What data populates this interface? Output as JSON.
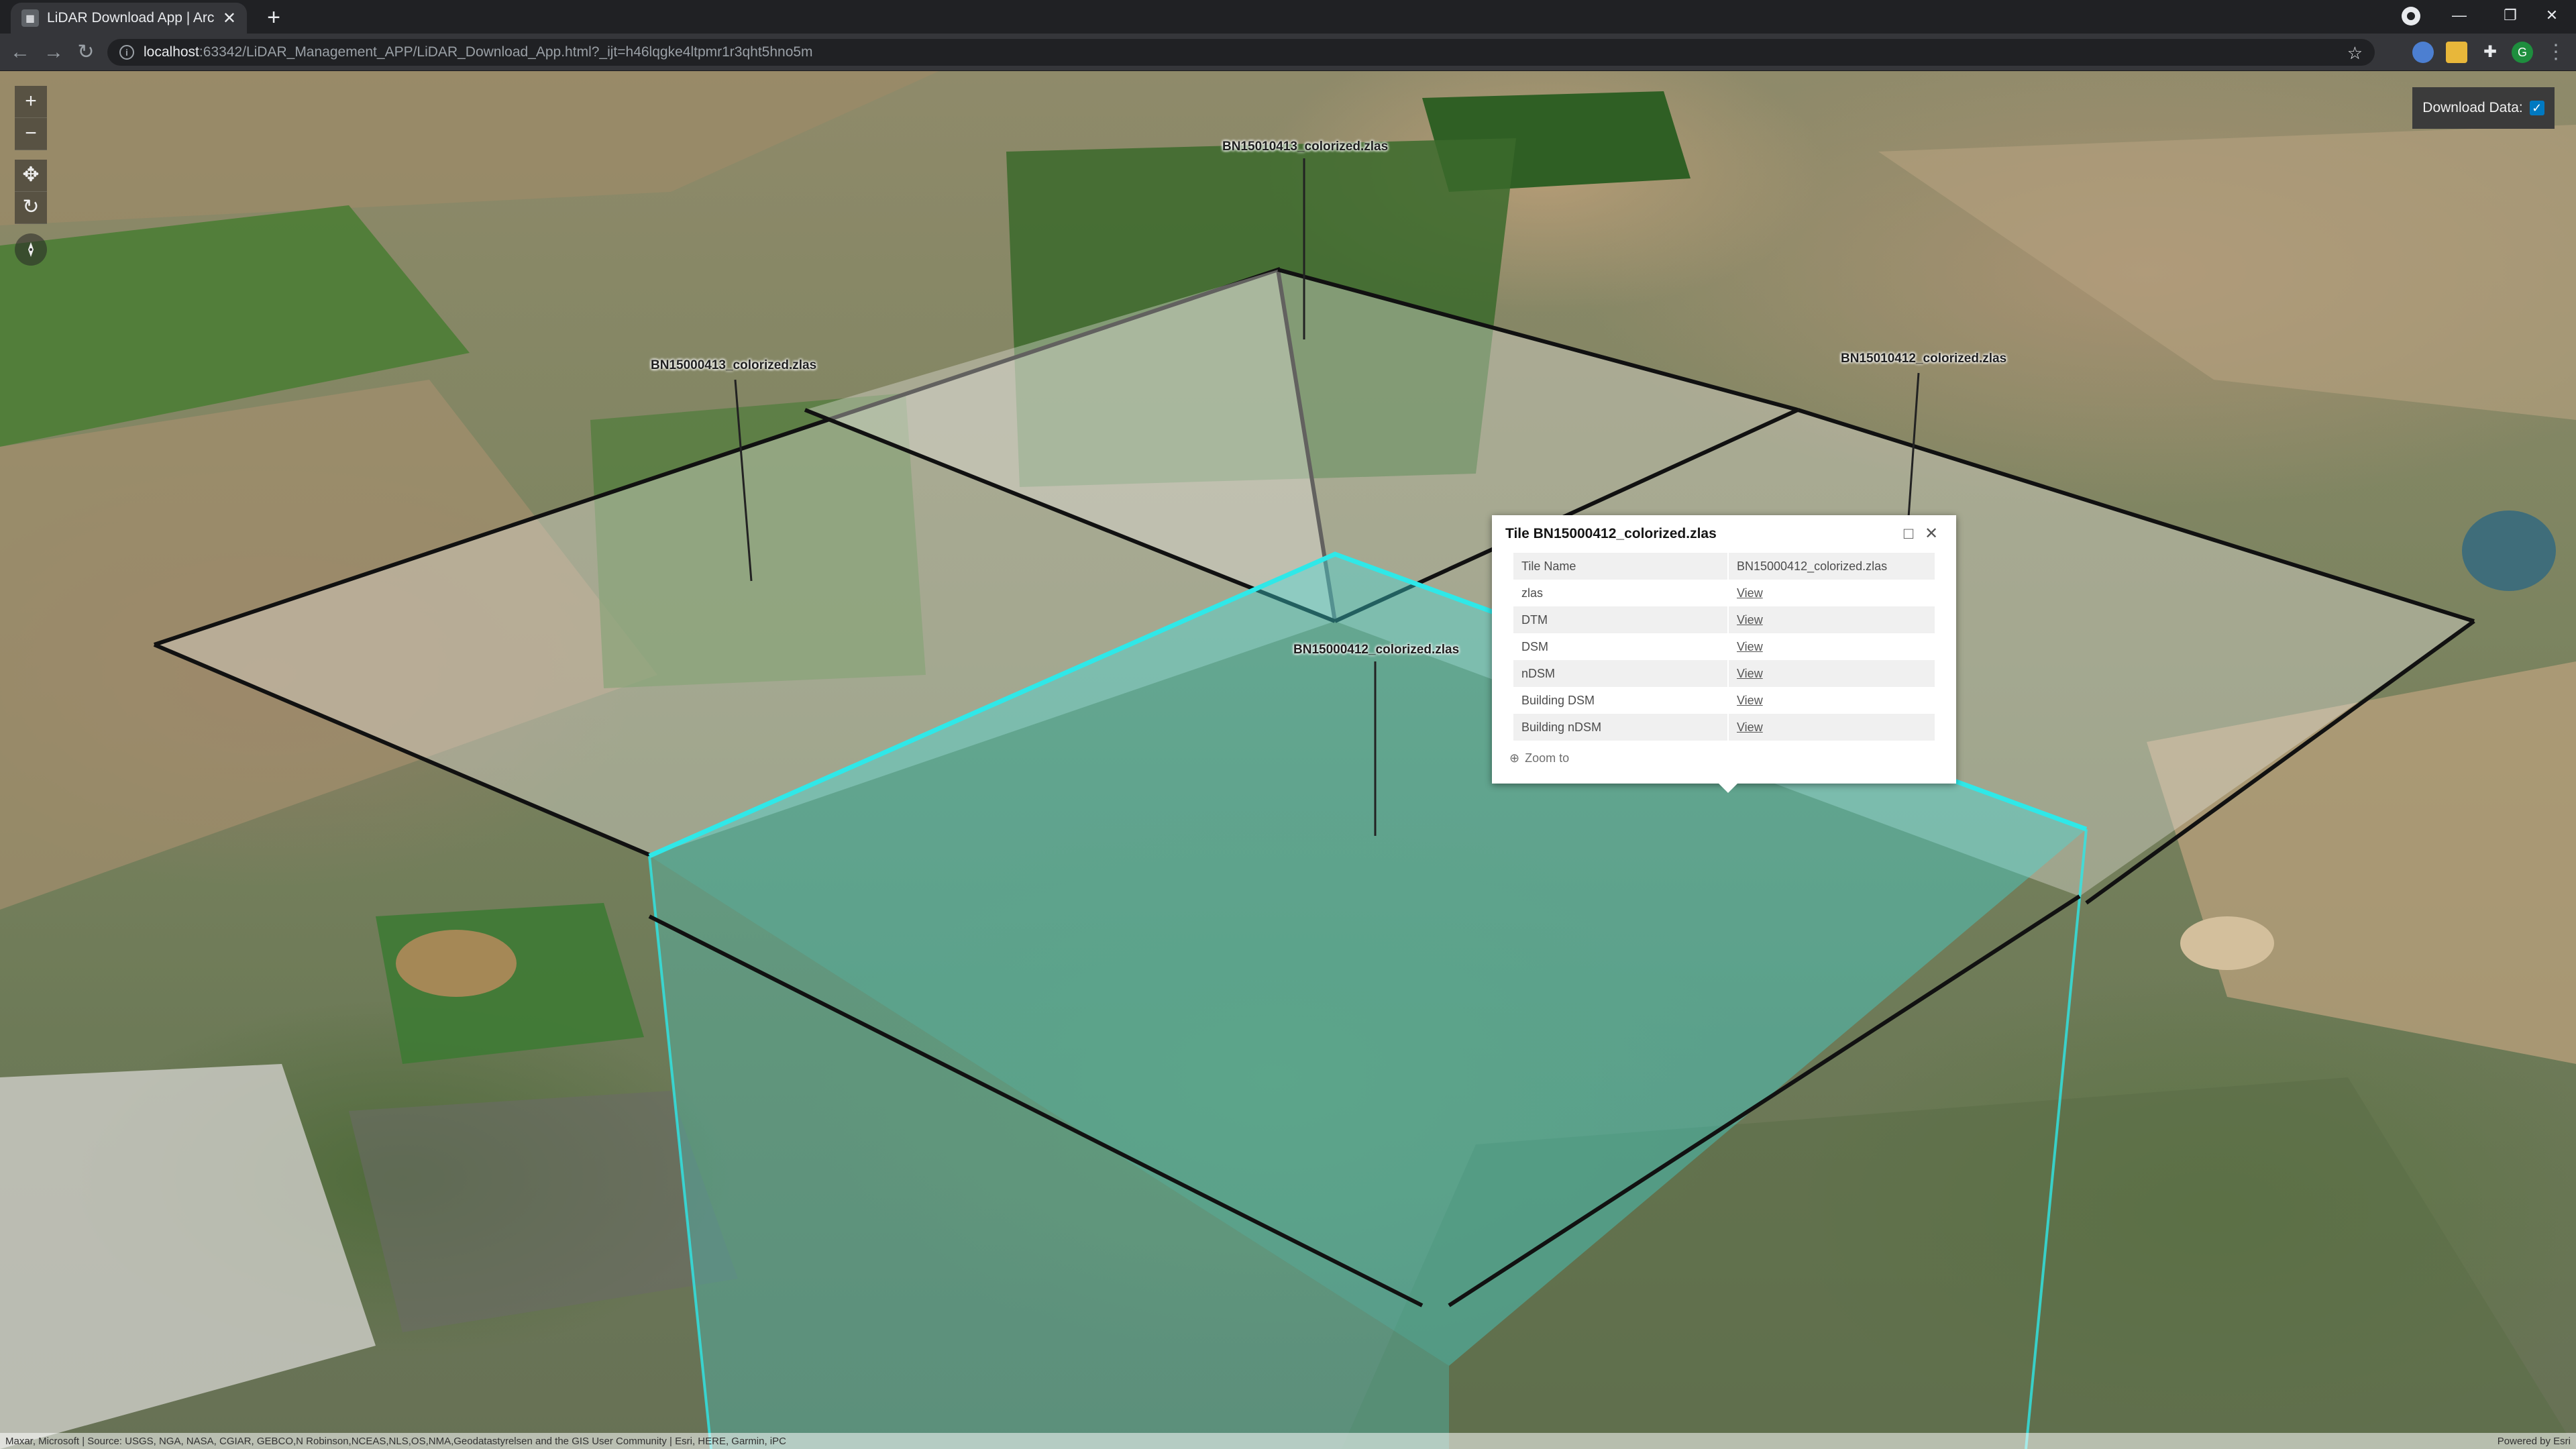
{
  "browser": {
    "tab_title": "LiDAR Download App | ArcGIS AI",
    "new_tab": "+",
    "url_host": "localhost",
    "url_rest": ":63342/LiDAR_Management_APP/LiDAR_Download_App.html?_ijt=h46lqgke4ltpmr1r3qht5hno5m",
    "profile_initial": "G"
  },
  "map": {
    "download_label": "Download Data:",
    "download_checked": true,
    "tiles": [
      "BN15010413_colorized.zlas",
      "BN15000413_colorized.zlas",
      "BN15010412_colorized.zlas",
      "BN15000412_colorized.zlas"
    ],
    "attribution": "Maxar, Microsoft | Source: USGS, NGA, NASA, CGIAR, GEBCO,N Robinson,NCEAS,NLS,OS,NMA,Geodatastyrelsen and the GIS User Community | Esri, HERE, Garmin, iPC",
    "powered_by": "Powered by Esri",
    "colors": {
      "selected_tile": "#3fe0e0",
      "tile_outline": "#111111"
    }
  },
  "popup": {
    "title": "Tile BN15000412_colorized.zlas",
    "rows": [
      {
        "key": "Tile Name",
        "value": "BN15000412_colorized.zlas"
      },
      {
        "key": "zlas",
        "value": "View"
      },
      {
        "key": "DTM",
        "value": "View"
      },
      {
        "key": "DSM",
        "value": "View"
      },
      {
        "key": "nDSM",
        "value": "View"
      },
      {
        "key": "Building DSM",
        "value": "View"
      },
      {
        "key": "Building nDSM",
        "value": "View"
      }
    ],
    "zoom_to": "Zoom to"
  }
}
